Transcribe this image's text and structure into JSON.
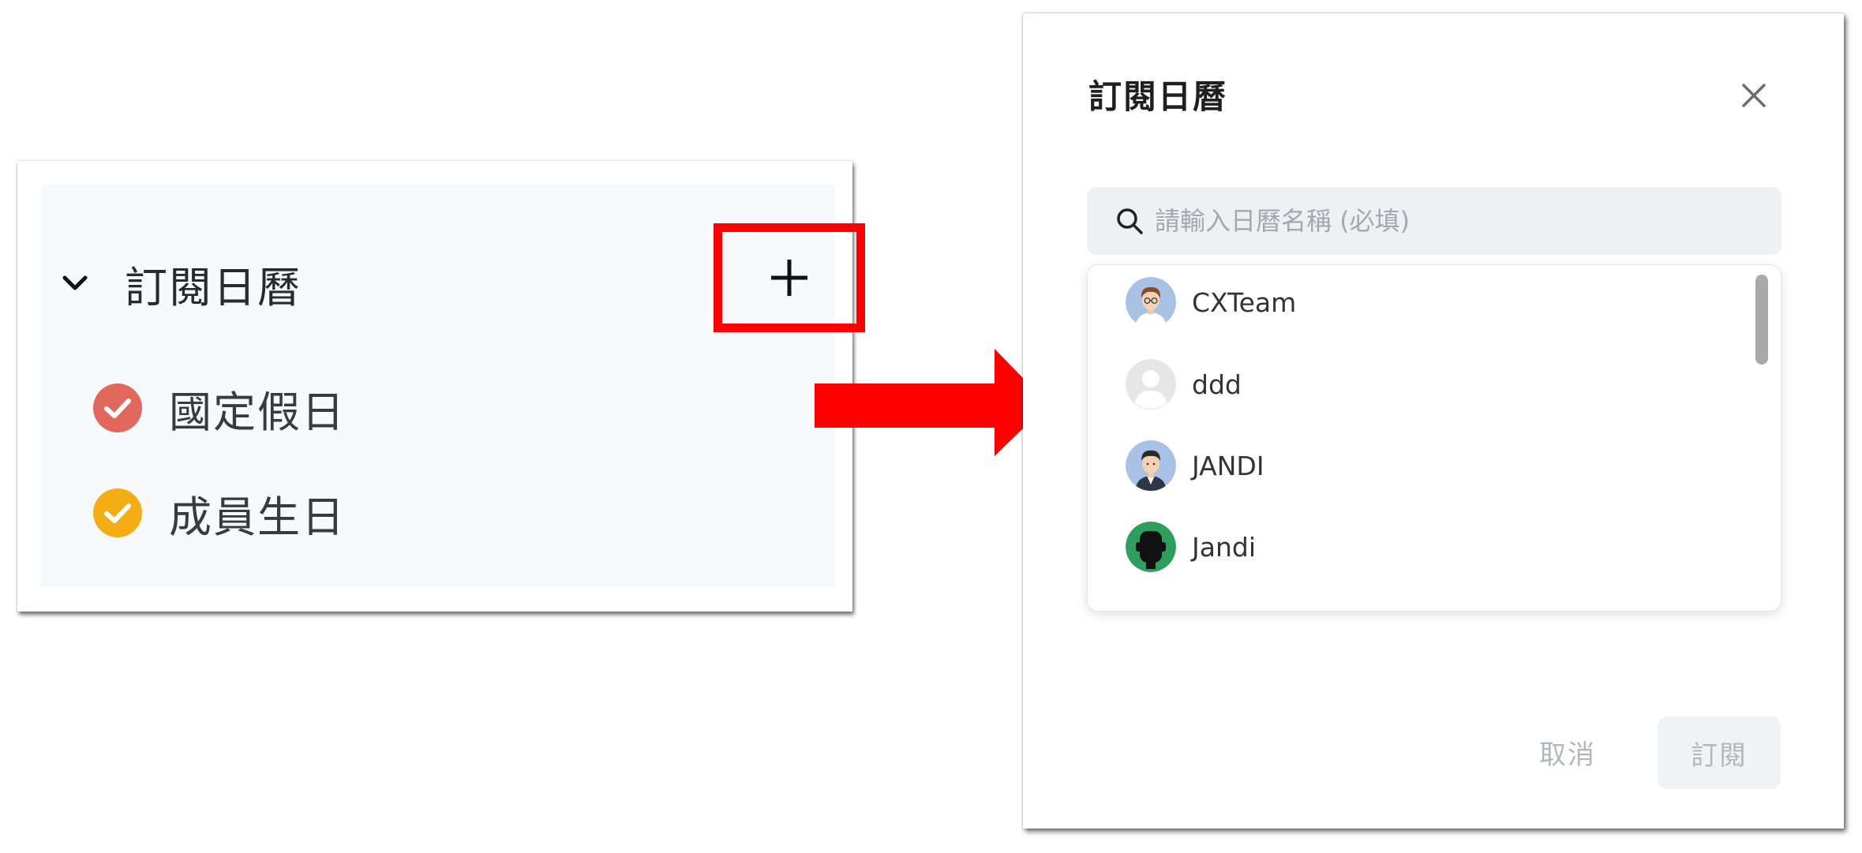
{
  "sidebar": {
    "section_title": "訂閱日曆",
    "add_icon": "plus-icon",
    "calendars": [
      {
        "label": "國定假日",
        "color": "#e0685c",
        "icon": "check-circle-icon"
      },
      {
        "label": "成員生日",
        "color": "#f5ad14",
        "icon": "check-circle-icon"
      }
    ]
  },
  "annotation": {
    "highlight_color": "#ff0000",
    "arrow_color": "#ff0000"
  },
  "modal": {
    "title": "訂閱日曆",
    "close_icon": "close-icon",
    "search": {
      "value": "",
      "placeholder": "請輸入日曆名稱 (必填)",
      "icon": "search-icon"
    },
    "results": [
      {
        "name": "CXTeam",
        "avatar": "avatar-cxteam"
      },
      {
        "name": "ddd",
        "avatar": "avatar-default"
      },
      {
        "name": "JANDI",
        "avatar": "avatar-jandi"
      },
      {
        "name": "Jandi",
        "avatar": "avatar-jandi-bot"
      }
    ],
    "cancel_label": "取消",
    "subscribe_label": "訂閱"
  }
}
